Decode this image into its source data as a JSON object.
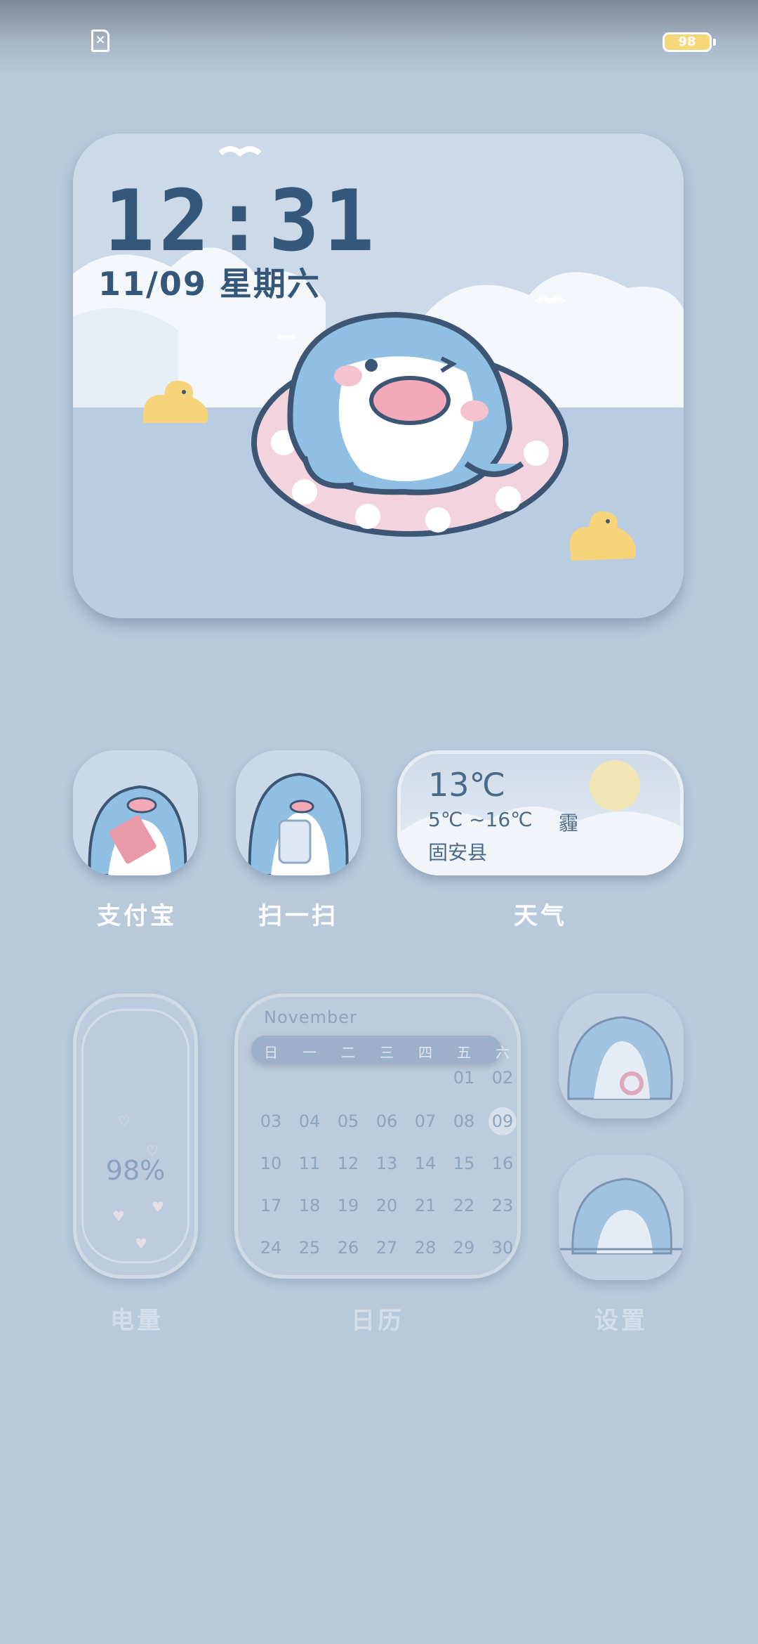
{
  "status_bar": {
    "sim_icon": "no-sim-icon",
    "battery": "98"
  },
  "clock_widget": {
    "time": "12:31",
    "date": "11/09 星期六"
  },
  "apps_row1": [
    {
      "label": "支付宝",
      "icon": "shark-holding-red-packet"
    },
    {
      "label": "扫一扫",
      "icon": "shark-holding-phone"
    }
  ],
  "weather": {
    "temp": "13℃",
    "range": "5℃ ~16℃",
    "condition": "霾",
    "location": "固安县",
    "label": "天气"
  },
  "battery_widget": {
    "percent": "98%",
    "label": "电量"
  },
  "calendar": {
    "month": "November",
    "weekdays": [
      "日",
      "一",
      "二",
      "三",
      "四",
      "五",
      "六"
    ],
    "today": "09",
    "weeks": [
      [
        "",
        "",
        "",
        "",
        "",
        "01",
        "02"
      ],
      [
        "03",
        "04",
        "05",
        "06",
        "07",
        "08",
        "09"
      ],
      [
        "10",
        "11",
        "12",
        "13",
        "14",
        "15",
        "16"
      ],
      [
        "17",
        "18",
        "19",
        "20",
        "21",
        "22",
        "23"
      ],
      [
        "24",
        "25",
        "26",
        "27",
        "28",
        "29",
        "30"
      ]
    ],
    "label": "日历"
  },
  "settings": {
    "label": "设置"
  },
  "colors": {
    "background": "#b8c9dc",
    "text_dark": "#35577a",
    "shark_blue": "#8fc0e4",
    "float_pink": "#f3d3dd",
    "duck_yellow": "#f7d37a"
  }
}
